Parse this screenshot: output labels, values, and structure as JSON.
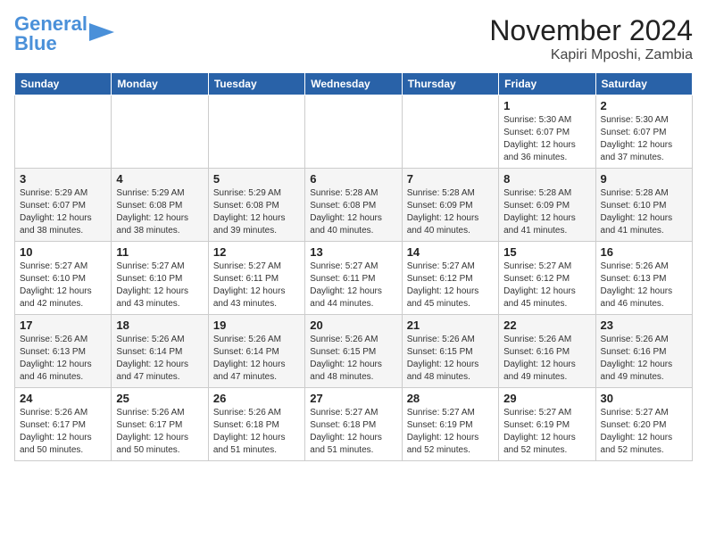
{
  "logo": {
    "text1": "General",
    "text2": "Blue"
  },
  "title": "November 2024",
  "location": "Kapiri Mposhi, Zambia",
  "days_of_week": [
    "Sunday",
    "Monday",
    "Tuesday",
    "Wednesday",
    "Thursday",
    "Friday",
    "Saturday"
  ],
  "weeks": [
    [
      {
        "day": "",
        "info": ""
      },
      {
        "day": "",
        "info": ""
      },
      {
        "day": "",
        "info": ""
      },
      {
        "day": "",
        "info": ""
      },
      {
        "day": "",
        "info": ""
      },
      {
        "day": "1",
        "info": "Sunrise: 5:30 AM\nSunset: 6:07 PM\nDaylight: 12 hours\nand 36 minutes."
      },
      {
        "day": "2",
        "info": "Sunrise: 5:30 AM\nSunset: 6:07 PM\nDaylight: 12 hours\nand 37 minutes."
      }
    ],
    [
      {
        "day": "3",
        "info": "Sunrise: 5:29 AM\nSunset: 6:07 PM\nDaylight: 12 hours\nand 38 minutes."
      },
      {
        "day": "4",
        "info": "Sunrise: 5:29 AM\nSunset: 6:08 PM\nDaylight: 12 hours\nand 38 minutes."
      },
      {
        "day": "5",
        "info": "Sunrise: 5:29 AM\nSunset: 6:08 PM\nDaylight: 12 hours\nand 39 minutes."
      },
      {
        "day": "6",
        "info": "Sunrise: 5:28 AM\nSunset: 6:08 PM\nDaylight: 12 hours\nand 40 minutes."
      },
      {
        "day": "7",
        "info": "Sunrise: 5:28 AM\nSunset: 6:09 PM\nDaylight: 12 hours\nand 40 minutes."
      },
      {
        "day": "8",
        "info": "Sunrise: 5:28 AM\nSunset: 6:09 PM\nDaylight: 12 hours\nand 41 minutes."
      },
      {
        "day": "9",
        "info": "Sunrise: 5:28 AM\nSunset: 6:10 PM\nDaylight: 12 hours\nand 41 minutes."
      }
    ],
    [
      {
        "day": "10",
        "info": "Sunrise: 5:27 AM\nSunset: 6:10 PM\nDaylight: 12 hours\nand 42 minutes."
      },
      {
        "day": "11",
        "info": "Sunrise: 5:27 AM\nSunset: 6:10 PM\nDaylight: 12 hours\nand 43 minutes."
      },
      {
        "day": "12",
        "info": "Sunrise: 5:27 AM\nSunset: 6:11 PM\nDaylight: 12 hours\nand 43 minutes."
      },
      {
        "day": "13",
        "info": "Sunrise: 5:27 AM\nSunset: 6:11 PM\nDaylight: 12 hours\nand 44 minutes."
      },
      {
        "day": "14",
        "info": "Sunrise: 5:27 AM\nSunset: 6:12 PM\nDaylight: 12 hours\nand 45 minutes."
      },
      {
        "day": "15",
        "info": "Sunrise: 5:27 AM\nSunset: 6:12 PM\nDaylight: 12 hours\nand 45 minutes."
      },
      {
        "day": "16",
        "info": "Sunrise: 5:26 AM\nSunset: 6:13 PM\nDaylight: 12 hours\nand 46 minutes."
      }
    ],
    [
      {
        "day": "17",
        "info": "Sunrise: 5:26 AM\nSunset: 6:13 PM\nDaylight: 12 hours\nand 46 minutes."
      },
      {
        "day": "18",
        "info": "Sunrise: 5:26 AM\nSunset: 6:14 PM\nDaylight: 12 hours\nand 47 minutes."
      },
      {
        "day": "19",
        "info": "Sunrise: 5:26 AM\nSunset: 6:14 PM\nDaylight: 12 hours\nand 47 minutes."
      },
      {
        "day": "20",
        "info": "Sunrise: 5:26 AM\nSunset: 6:15 PM\nDaylight: 12 hours\nand 48 minutes."
      },
      {
        "day": "21",
        "info": "Sunrise: 5:26 AM\nSunset: 6:15 PM\nDaylight: 12 hours\nand 48 minutes."
      },
      {
        "day": "22",
        "info": "Sunrise: 5:26 AM\nSunset: 6:16 PM\nDaylight: 12 hours\nand 49 minutes."
      },
      {
        "day": "23",
        "info": "Sunrise: 5:26 AM\nSunset: 6:16 PM\nDaylight: 12 hours\nand 49 minutes."
      }
    ],
    [
      {
        "day": "24",
        "info": "Sunrise: 5:26 AM\nSunset: 6:17 PM\nDaylight: 12 hours\nand 50 minutes."
      },
      {
        "day": "25",
        "info": "Sunrise: 5:26 AM\nSunset: 6:17 PM\nDaylight: 12 hours\nand 50 minutes."
      },
      {
        "day": "26",
        "info": "Sunrise: 5:26 AM\nSunset: 6:18 PM\nDaylight: 12 hours\nand 51 minutes."
      },
      {
        "day": "27",
        "info": "Sunrise: 5:27 AM\nSunset: 6:18 PM\nDaylight: 12 hours\nand 51 minutes."
      },
      {
        "day": "28",
        "info": "Sunrise: 5:27 AM\nSunset: 6:19 PM\nDaylight: 12 hours\nand 52 minutes."
      },
      {
        "day": "29",
        "info": "Sunrise: 5:27 AM\nSunset: 6:19 PM\nDaylight: 12 hours\nand 52 minutes."
      },
      {
        "day": "30",
        "info": "Sunrise: 5:27 AM\nSunset: 6:20 PM\nDaylight: 12 hours\nand 52 minutes."
      }
    ]
  ]
}
